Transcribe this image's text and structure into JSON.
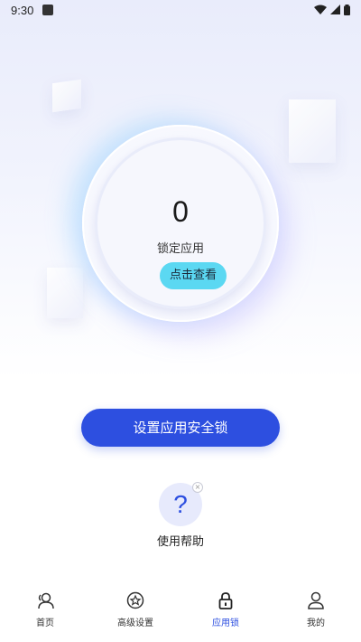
{
  "status_bar": {
    "time": "9:30"
  },
  "lock_card": {
    "count": "0",
    "label": "锁定应用",
    "view_button": "点击查看"
  },
  "main_action": {
    "label": "设置应用安全锁"
  },
  "help": {
    "icon_text": "?",
    "label": "使用帮助",
    "close_symbol": "×"
  },
  "tabs": [
    {
      "label": "首页",
      "icon": "people-icon",
      "active": false
    },
    {
      "label": "高级设置",
      "icon": "star-circle-icon",
      "active": false
    },
    {
      "label": "应用锁",
      "icon": "lock-icon",
      "active": true
    },
    {
      "label": "我的",
      "icon": "person-icon",
      "active": false
    }
  ],
  "colors": {
    "accent": "#2d4fe0",
    "view_button": "#5bd8f2",
    "active_tab": "#2d4fe0"
  }
}
